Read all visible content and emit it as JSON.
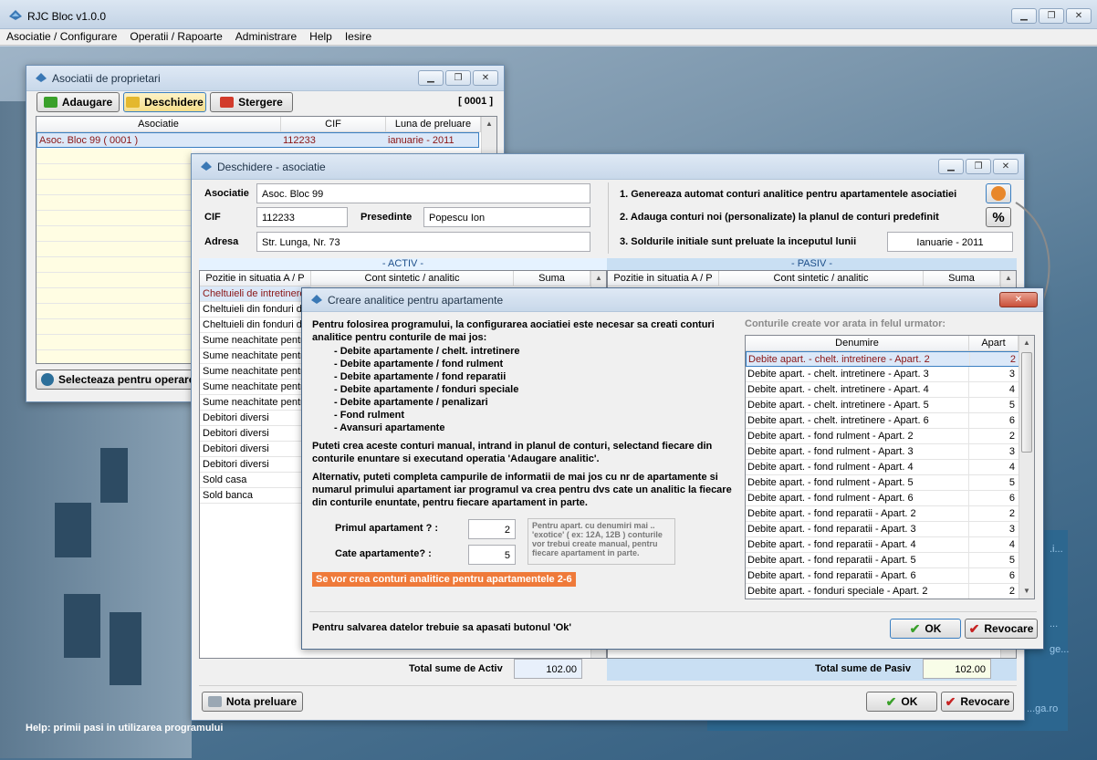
{
  "app": {
    "title": "RJC Bloc v1.0.0"
  },
  "menu": [
    "Asociatie / Configurare",
    "Operatii / Rapoarte",
    "Administrare",
    "Help",
    "Iesire"
  ],
  "status_help": "Help: primii pasi in utilizarea programului",
  "bg_links": [
    ".i...",
    "...",
    "...",
    "ge...",
    "...ga.ro"
  ],
  "assoc_window": {
    "title": "Asociatii de proprietari",
    "add_label": "Adaugare",
    "open_label": "Deschidere",
    "delete_label": "Stergere",
    "code": "[ 0001 ]",
    "columns": [
      "Asociatie",
      "CIF",
      "Luna de preluare"
    ],
    "rows": [
      {
        "name": "Asoc. Bloc 99 ( 0001 )",
        "cif": "112233",
        "luna": "ianuarie - 2011"
      }
    ],
    "select_label": "Selecteaza pentru operare"
  },
  "open_window": {
    "title": "Deschidere - asociatie",
    "asociatie_label": "Asociatie",
    "asociatie_value": "Asoc. Bloc 99",
    "cif_label": "CIF",
    "cif_value": "112233",
    "presedinte_label": "Presedinte",
    "presedinte_value": "Popescu Ion",
    "adresa_label": "Adresa",
    "adresa_value": "Str. Lunga, Nr. 73",
    "step1": "1. Genereaza automat conturi analitice pentru apartamentele asociatiei",
    "step2": "2. Adauga conturi noi (personalizate) la planul de conturi predefinit",
    "step3": "3. Soldurile initiale sunt preluate la inceputul lunii",
    "luna_value": "Ianuarie - 2011",
    "activ_header": "- ACTIV -",
    "pasiv_header": "- PASIV -",
    "columns": [
      "Pozitie in situatia A / P",
      "Cont sintetic / analitic",
      "Suma"
    ],
    "activ_rows": [
      "Cheltuieli de intretinere",
      "Cheltuieli din fonduri div",
      "Cheltuieli din fonduri div",
      "Sume neachitate pentr",
      "Sume neachitate pentr",
      "Sume neachitate pentr",
      "Sume neachitate pentr",
      "Sume neachitate pentr",
      "Debitori diversi",
      "Debitori diversi",
      "Debitori diversi",
      "Debitori diversi",
      "Sold casa",
      "Sold banca"
    ],
    "total_activ_label": "Total sume de Activ",
    "total_activ_value": "102.00",
    "total_pasiv_label": "Total sume de Pasiv",
    "total_pasiv_value": "102.00",
    "nota_label": "Nota preluare",
    "ok_label": "OK",
    "revocare_label": "Revocare"
  },
  "dialog": {
    "title": "Creare analitice pentru apartamente",
    "intro": "Pentru folosirea programului, la configurarea aociatiei este necesar sa creati conturi analitice pentru conturile de mai jos:",
    "items": [
      "- Debite apartamente / chelt. intretinere",
      "- Debite apartamente / fond rulment",
      "- Debite apartamente / fond reparatii",
      "- Debite apartamente / fonduri speciale",
      "- Debite apartamente / penalizari",
      "- Fond rulment",
      "- Avansuri apartamente"
    ],
    "para2": "Puteti crea aceste conturi manual, intrand in planul de conturi, selectand fiecare din conturile enuntare si executand operatia 'Adaugare analitic'.",
    "para3": "Alternativ, puteti completa campurile de informatii de mai jos cu nr de apartamente si numarul primului apartament iar programul va crea pentru dvs cate un analitic la fiecare din conturile enuntate, pentru fiecare apartament in parte.",
    "primul_label": "Primul apartament ? :",
    "primul_value": "2",
    "cate_label": "Cate apartamente? :",
    "cate_value": "5",
    "hint": "Pentru apart. cu denumiri mai .. 'exotice' ( ex: 12A, 12B ) conturile vor trebui create manual, pentru fiecare apartament in parte.",
    "result": "Se vor crea conturi analitice pentru apartamentele 2-6",
    "preview_title": "Conturile create vor arata in felul urmator:",
    "preview_columns": [
      "Denumire",
      "Apart"
    ],
    "preview_rows": [
      {
        "d": "Debite apart. - chelt. intretinere - Apart. 2",
        "a": "2"
      },
      {
        "d": "Debite apart. - chelt. intretinere - Apart. 3",
        "a": "3"
      },
      {
        "d": "Debite apart. - chelt. intretinere - Apart. 4",
        "a": "4"
      },
      {
        "d": "Debite apart. - chelt. intretinere - Apart. 5",
        "a": "5"
      },
      {
        "d": "Debite apart. - chelt. intretinere - Apart. 6",
        "a": "6"
      },
      {
        "d": "Debite apart. - fond rulment - Apart. 2",
        "a": "2"
      },
      {
        "d": "Debite apart. - fond rulment - Apart. 3",
        "a": "3"
      },
      {
        "d": "Debite apart. - fond rulment - Apart. 4",
        "a": "4"
      },
      {
        "d": "Debite apart. - fond rulment - Apart. 5",
        "a": "5"
      },
      {
        "d": "Debite apart. - fond rulment - Apart. 6",
        "a": "6"
      },
      {
        "d": "Debite apart. - fond reparatii - Apart. 2",
        "a": "2"
      },
      {
        "d": "Debite apart. - fond reparatii - Apart. 3",
        "a": "3"
      },
      {
        "d": "Debite apart. - fond reparatii - Apart. 4",
        "a": "4"
      },
      {
        "d": "Debite apart. - fond reparatii - Apart. 5",
        "a": "5"
      },
      {
        "d": "Debite apart. - fond reparatii - Apart. 6",
        "a": "6"
      },
      {
        "d": "Debite apart. - fonduri speciale - Apart. 2",
        "a": "2"
      }
    ],
    "footer_note": "Pentru salvarea datelor trebuie sa apasati butonul 'Ok'",
    "ok_label": "OK",
    "revocare_label": "Revocare"
  }
}
